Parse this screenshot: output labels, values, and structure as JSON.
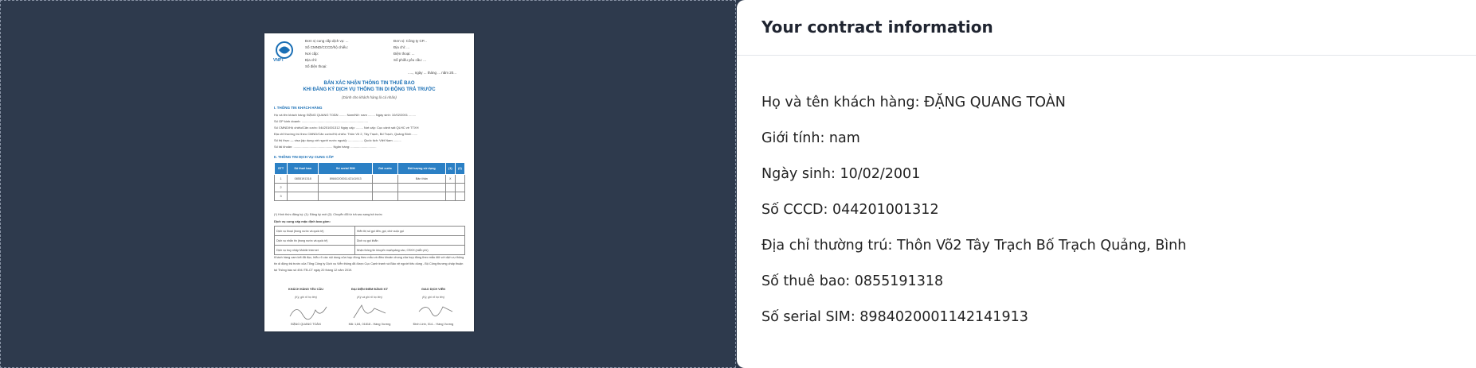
{
  "document": {
    "logo_text": "VNPT",
    "header_left": [
      "Đơn vị cung cấp dịch vụ: ...",
      "Số CMND/CCCD/hộ chiếu:",
      "Nơi cấp:",
      "Địa chỉ:",
      "Số điện thoại:"
    ],
    "header_right": [
      "Đơn vị: Công ty CP...",
      "Địa chỉ: ...",
      "Điện thoại: ...",
      "Số phiếu yêu cầu: ..."
    ],
    "date_line": "....., ngày ... tháng ... năm 20...",
    "title_line1": "BẢN XÁC NHẬN THÔNG TIN THUÊ BAO",
    "title_line2": "KHI ĐĂNG KÝ DỊCH VỤ THÔNG TIN DI ĐỘNG TRẢ TRƯỚC",
    "title_line3": "(Dành cho khách hàng là cá nhân)",
    "section1": "I. THÔNG TIN KHÁCH HÀNG",
    "section1_lines": [
      "Họ và tên khách hàng: ĐẶNG QUANG TOÀN ........ Nam/Nữ: nam ........ Ngày sinh: 10/02/2001 ........",
      "Số GP kinh doanh: ...........................................................................",
      "Số CMND/Hộ chiếu/Căn cước: 044201001312 Ngày cấp: ........ Nơi cấp: Cục cảnh sát QLHC về TTXH",
      "Địa chỉ thường trú theo CMND/Căn cước/Hộ chiếu: Thôn Võ 2, Tây Trạch, Bố Trạch, Quảng Bình ......",
      "Số thị thực — visa (áp dụng với người nước ngoài): ................. Quốc tịch: Việt Nam .........",
      "Số tài khoản: ............................................ Ngân hàng: ............................."
    ],
    "section2": "II. THÔNG TIN DỊCH VỤ CUNG CẤP",
    "table_headers": [
      "STT",
      "Số thuê bao",
      "Số serial SIM",
      "Gói cước",
      "Đối tượng sử dụng",
      "(1)",
      "(2)"
    ],
    "table_rows": [
      [
        "1",
        "0855191318",
        "8984020001142141913",
        "",
        "Bản thân",
        "X",
        ""
      ],
      [
        "2",
        "",
        "",
        "",
        "",
        "",
        ""
      ],
      [
        "3",
        "",
        "",
        "",
        "",
        "",
        ""
      ]
    ],
    "note": "(*) Hình thức đăng ký:    (1): Đăng ký mới    (2): Chuyển đổi từ trả sau sang trả trước",
    "subheading": "Dịch vụ cung cấp mặc định bao gồm:",
    "services": [
      [
        "Dịch vụ thoại (trong nước và quốc tế)",
        "Hiển thị số gọi đến, gọi, chờ cuộc gọi"
      ],
      [
        "Dịch vụ nhắn tin (trong nước và quốc tế)",
        "Dịch vụ gọi khẩn"
      ],
      [
        "Dịch vụ truy nhập Mobile Internet",
        "Nhận thông tin khuyến mại/quảng cáo, CSKH (miễn phí)"
      ]
    ],
    "paragraph": "Khách hàng cam kết đã đọc, hiểu rõ các nội dung của hợp đồng theo mẫu và điều khoản chung của hợp đồng theo mẫu đối với dịch vụ thông tin di động trả trước của Tổng Công ty Dịch vụ Viễn thông đã được Cục Cạnh tranh và Bảo vệ người tiêu dùng - Bộ Công thương chấp thuận tại Thông báo số 494 /TB-CT ngày 20 tháng 12 năm 2019.",
    "signers": [
      {
        "role": "KHÁCH HÀNG YÊU CẦU",
        "sub": "(Ký, ghi rõ họ tên)",
        "name": "ĐẶNG QUANG TOÀN"
      },
      {
        "role": "ĐẠI DIỆN ĐIỂM ĐĂNG KÝ",
        "sub": "(Ký và ghi rõ họ tên)",
        "name": "Mã: 1,84, 01818 - Hàng Vương"
      },
      {
        "role": "GIAO DỊCH VIÊN",
        "sub": "(Ký, ghi rõ họ tên)",
        "name": "Đinh Linh, 014... Hàng Vương"
      }
    ]
  },
  "panel": {
    "title": "Your contract information",
    "fields": [
      "Họ và tên khách hàng: ĐẶNG QUANG TOÀN",
      "Giới tính: nam",
      "Ngày sinh: 10/02/2001",
      "Số CCCD: 044201001312",
      "Địa chỉ thường trú: Thôn Võ2 Tây Trạch Bố Trạch Quảng, Bình",
      "Số thuê bao: 0855191318",
      "Số serial SIM: 8984020001142141913"
    ]
  },
  "colors": {
    "left_background": "#2e3a4d",
    "doc_accent": "#1a6fb5",
    "panel_background": "#ffffff"
  }
}
